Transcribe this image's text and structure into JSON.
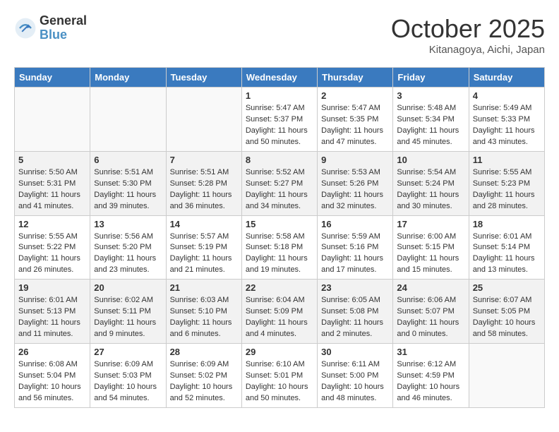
{
  "logo": {
    "general": "General",
    "blue": "Blue"
  },
  "title": "October 2025",
  "location": "Kitanagoya, Aichi, Japan",
  "weekdays": [
    "Sunday",
    "Monday",
    "Tuesday",
    "Wednesday",
    "Thursday",
    "Friday",
    "Saturday"
  ],
  "weeks": [
    [
      {
        "day": "",
        "info": ""
      },
      {
        "day": "",
        "info": ""
      },
      {
        "day": "",
        "info": ""
      },
      {
        "day": "1",
        "info": "Sunrise: 5:47 AM\nSunset: 5:37 PM\nDaylight: 11 hours\nand 50 minutes."
      },
      {
        "day": "2",
        "info": "Sunrise: 5:47 AM\nSunset: 5:35 PM\nDaylight: 11 hours\nand 47 minutes."
      },
      {
        "day": "3",
        "info": "Sunrise: 5:48 AM\nSunset: 5:34 PM\nDaylight: 11 hours\nand 45 minutes."
      },
      {
        "day": "4",
        "info": "Sunrise: 5:49 AM\nSunset: 5:33 PM\nDaylight: 11 hours\nand 43 minutes."
      }
    ],
    [
      {
        "day": "5",
        "info": "Sunrise: 5:50 AM\nSunset: 5:31 PM\nDaylight: 11 hours\nand 41 minutes."
      },
      {
        "day": "6",
        "info": "Sunrise: 5:51 AM\nSunset: 5:30 PM\nDaylight: 11 hours\nand 39 minutes."
      },
      {
        "day": "7",
        "info": "Sunrise: 5:51 AM\nSunset: 5:28 PM\nDaylight: 11 hours\nand 36 minutes."
      },
      {
        "day": "8",
        "info": "Sunrise: 5:52 AM\nSunset: 5:27 PM\nDaylight: 11 hours\nand 34 minutes."
      },
      {
        "day": "9",
        "info": "Sunrise: 5:53 AM\nSunset: 5:26 PM\nDaylight: 11 hours\nand 32 minutes."
      },
      {
        "day": "10",
        "info": "Sunrise: 5:54 AM\nSunset: 5:24 PM\nDaylight: 11 hours\nand 30 minutes."
      },
      {
        "day": "11",
        "info": "Sunrise: 5:55 AM\nSunset: 5:23 PM\nDaylight: 11 hours\nand 28 minutes."
      }
    ],
    [
      {
        "day": "12",
        "info": "Sunrise: 5:55 AM\nSunset: 5:22 PM\nDaylight: 11 hours\nand 26 minutes."
      },
      {
        "day": "13",
        "info": "Sunrise: 5:56 AM\nSunset: 5:20 PM\nDaylight: 11 hours\nand 23 minutes."
      },
      {
        "day": "14",
        "info": "Sunrise: 5:57 AM\nSunset: 5:19 PM\nDaylight: 11 hours\nand 21 minutes."
      },
      {
        "day": "15",
        "info": "Sunrise: 5:58 AM\nSunset: 5:18 PM\nDaylight: 11 hours\nand 19 minutes."
      },
      {
        "day": "16",
        "info": "Sunrise: 5:59 AM\nSunset: 5:16 PM\nDaylight: 11 hours\nand 17 minutes."
      },
      {
        "day": "17",
        "info": "Sunrise: 6:00 AM\nSunset: 5:15 PM\nDaylight: 11 hours\nand 15 minutes."
      },
      {
        "day": "18",
        "info": "Sunrise: 6:01 AM\nSunset: 5:14 PM\nDaylight: 11 hours\nand 13 minutes."
      }
    ],
    [
      {
        "day": "19",
        "info": "Sunrise: 6:01 AM\nSunset: 5:13 PM\nDaylight: 11 hours\nand 11 minutes."
      },
      {
        "day": "20",
        "info": "Sunrise: 6:02 AM\nSunset: 5:11 PM\nDaylight: 11 hours\nand 9 minutes."
      },
      {
        "day": "21",
        "info": "Sunrise: 6:03 AM\nSunset: 5:10 PM\nDaylight: 11 hours\nand 6 minutes."
      },
      {
        "day": "22",
        "info": "Sunrise: 6:04 AM\nSunset: 5:09 PM\nDaylight: 11 hours\nand 4 minutes."
      },
      {
        "day": "23",
        "info": "Sunrise: 6:05 AM\nSunset: 5:08 PM\nDaylight: 11 hours\nand 2 minutes."
      },
      {
        "day": "24",
        "info": "Sunrise: 6:06 AM\nSunset: 5:07 PM\nDaylight: 11 hours\nand 0 minutes."
      },
      {
        "day": "25",
        "info": "Sunrise: 6:07 AM\nSunset: 5:05 PM\nDaylight: 10 hours\nand 58 minutes."
      }
    ],
    [
      {
        "day": "26",
        "info": "Sunrise: 6:08 AM\nSunset: 5:04 PM\nDaylight: 10 hours\nand 56 minutes."
      },
      {
        "day": "27",
        "info": "Sunrise: 6:09 AM\nSunset: 5:03 PM\nDaylight: 10 hours\nand 54 minutes."
      },
      {
        "day": "28",
        "info": "Sunrise: 6:09 AM\nSunset: 5:02 PM\nDaylight: 10 hours\nand 52 minutes."
      },
      {
        "day": "29",
        "info": "Sunrise: 6:10 AM\nSunset: 5:01 PM\nDaylight: 10 hours\nand 50 minutes."
      },
      {
        "day": "30",
        "info": "Sunrise: 6:11 AM\nSunset: 5:00 PM\nDaylight: 10 hours\nand 48 minutes."
      },
      {
        "day": "31",
        "info": "Sunrise: 6:12 AM\nSunset: 4:59 PM\nDaylight: 10 hours\nand 46 minutes."
      },
      {
        "day": "",
        "info": ""
      }
    ]
  ]
}
